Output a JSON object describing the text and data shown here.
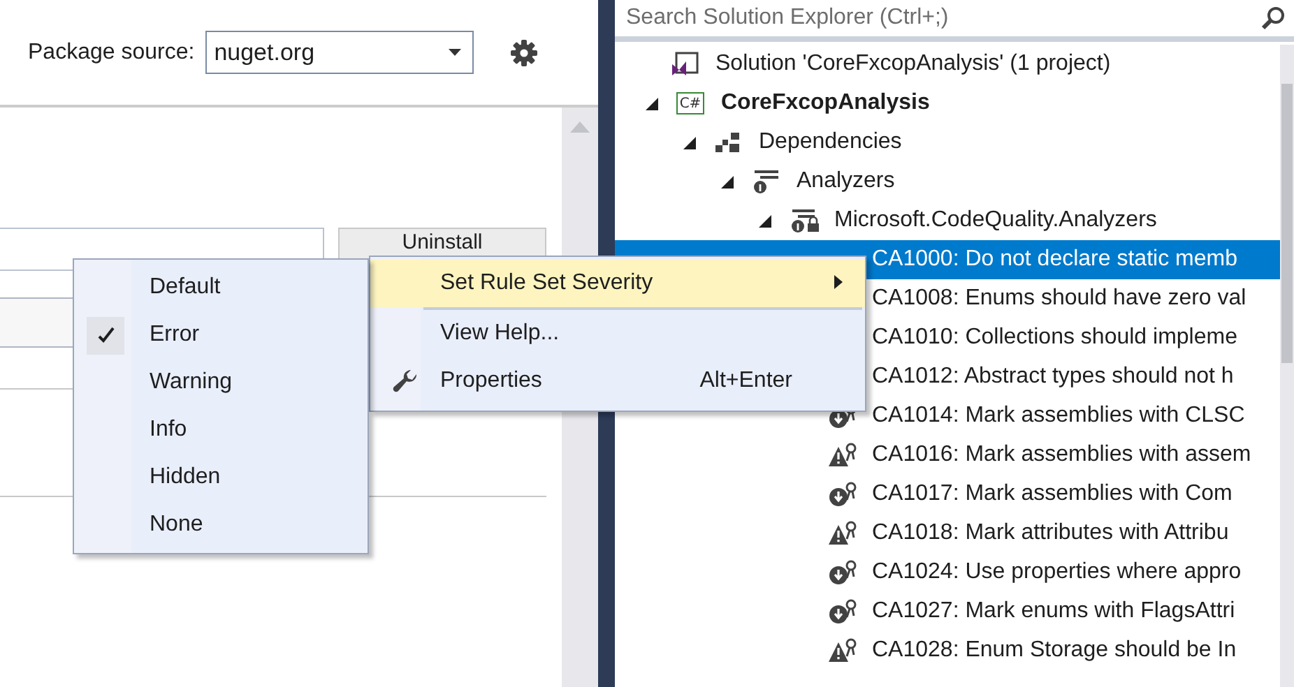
{
  "package_manager": {
    "source_label": "Package source:",
    "source_value": "nuget.org",
    "uninstall_button": "Uninstall"
  },
  "solution_explorer": {
    "search": {
      "placeholder": "Search Solution Explorer (Ctrl+;)"
    },
    "tree": [
      {
        "label": "Solution 'CoreFxcopAnalysis' (1 project)",
        "kind": "solution",
        "selected": false,
        "children": [
          {
            "label": "CoreFxcopAnalysis",
            "kind": "project",
            "badge": "C#",
            "selected": false,
            "expanded": true,
            "children": [
              {
                "label": "Dependencies",
                "kind": "dependencies",
                "selected": false,
                "expanded": true,
                "children": [
                  {
                    "label": "Analyzers",
                    "kind": "analyzers",
                    "selected": false,
                    "expanded": true,
                    "children": [
                      {
                        "label": "Microsoft.CodeQuality.Analyzers",
                        "kind": "analyzer",
                        "selected": false,
                        "expanded": true,
                        "children": [
                          {
                            "label": "CA1000: Do not declare static memb",
                            "kind": "rule",
                            "selected": true
                          },
                          {
                            "label": "CA1008: Enums should have zero val",
                            "kind": "rule",
                            "selected": false
                          },
                          {
                            "label": "CA1010: Collections should impleme",
                            "kind": "rule",
                            "selected": false
                          },
                          {
                            "label": "CA1012: Abstract types should not h",
                            "kind": "rule",
                            "selected": false
                          },
                          {
                            "label": "CA1014: Mark assemblies with CLSC",
                            "kind": "suggestion",
                            "selected": false
                          },
                          {
                            "label": "CA1016: Mark assemblies with assem",
                            "kind": "warning",
                            "selected": false
                          },
                          {
                            "label": "CA1017: Mark assemblies with Com",
                            "kind": "suggestion",
                            "selected": false
                          },
                          {
                            "label": "CA1018: Mark attributes with Attribu",
                            "kind": "warning",
                            "selected": false
                          },
                          {
                            "label": "CA1024: Use properties where appro",
                            "kind": "suggestion",
                            "selected": false
                          },
                          {
                            "label": "CA1027: Mark enums with FlagsAttri",
                            "kind": "suggestion",
                            "selected": false
                          },
                          {
                            "label": "CA1028: Enum Storage should be In",
                            "kind": "warning",
                            "selected": false
                          }
                        ]
                      }
                    ]
                  }
                ]
              }
            ]
          }
        ]
      }
    ]
  },
  "context_menu": {
    "items": [
      {
        "label": "Set Rule Set Severity",
        "kind": "submenu",
        "selected": true
      },
      {
        "kind": "separator"
      },
      {
        "label": "View Help...",
        "kind": "command",
        "selected": false
      },
      {
        "label": "Properties",
        "kind": "properties",
        "shortcut": "Alt+Enter",
        "selected": false
      }
    ]
  },
  "severity_menu": {
    "items": [
      {
        "label": "Default",
        "checked": false
      },
      {
        "label": "Error",
        "checked": true
      },
      {
        "label": "Warning",
        "checked": false
      },
      {
        "label": "Info",
        "checked": false
      },
      {
        "label": "Hidden",
        "checked": false
      },
      {
        "label": "None",
        "checked": false
      }
    ]
  }
}
